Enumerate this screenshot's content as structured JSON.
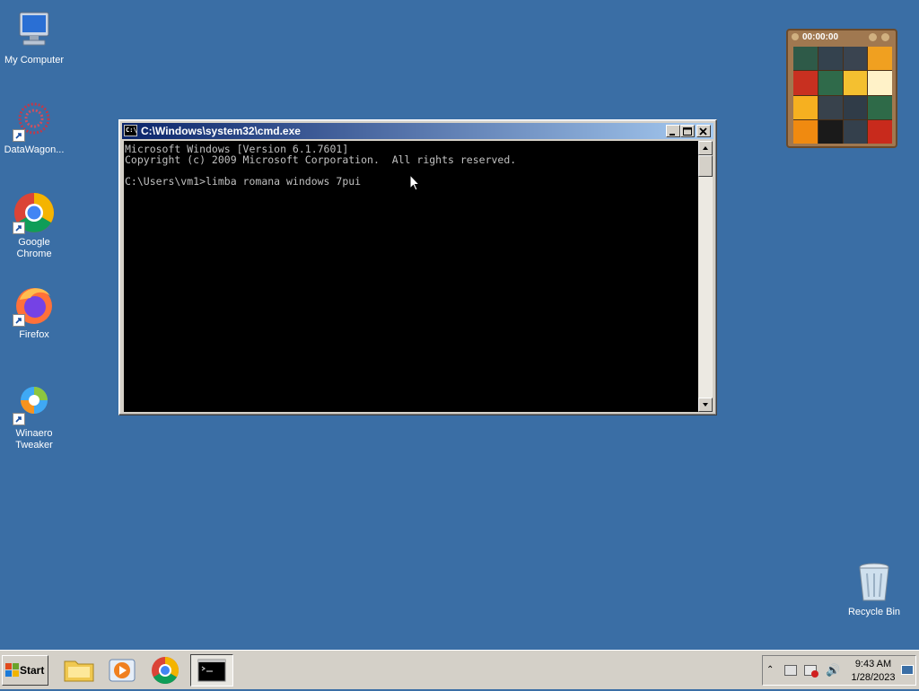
{
  "desktop": {
    "icons": [
      {
        "label": "My Computer"
      },
      {
        "label": "DataWagon..."
      },
      {
        "label": "Google Chrome"
      },
      {
        "label": "Firefox"
      },
      {
        "label": "Winaero Tweaker"
      },
      {
        "label": "Recycle Bin"
      }
    ]
  },
  "cmd_window": {
    "title": "C:\\Windows\\system32\\cmd.exe",
    "icon_text": "C:\\",
    "lines": [
      "Microsoft Windows [Version 6.1.7601]",
      "Copyright (c) 2009 Microsoft Corporation.  All rights reserved.",
      "",
      "C:\\Users\\vm1>limba romana windows 7pui"
    ]
  },
  "gadget": {
    "timer": "00:00:00"
  },
  "taskbar": {
    "start_label": "Start",
    "clock_time": "9:43 AM",
    "clock_date": "1/28/2023"
  },
  "colors": {
    "desktop": "#3a6ea5",
    "titlebar_start": "#0a246a",
    "titlebar_end": "#a6caf0",
    "console_bg": "#000000",
    "console_fg": "#c0c0c0"
  }
}
